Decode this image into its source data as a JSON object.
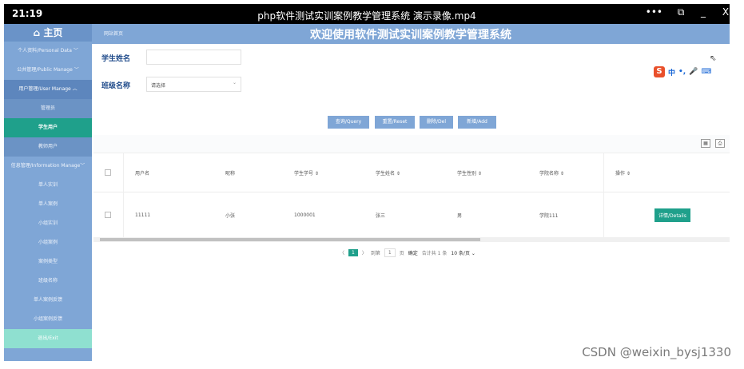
{
  "titlebar": {
    "time": "21:19",
    "title": "php软件测试实训案例教学管理系统 演示录像.mp4",
    "icons": [
      "more-icon",
      "pip-icon",
      "minimize-icon",
      "close-icon"
    ],
    "icon_glyphs": [
      "•••",
      "⧉",
      "_",
      "X"
    ]
  },
  "sidebar": {
    "home": "⌂ 主页",
    "items": [
      {
        "label": "个人资料/Personal Data  ﹀",
        "state": "normal"
      },
      {
        "label": "公共管理/Public Manage  ﹀",
        "state": "normal"
      },
      {
        "label": "用户管理/User Manage  ︿",
        "state": "expanded"
      },
      {
        "label": "管理员",
        "state": "sub"
      },
      {
        "label": "学生用户",
        "state": "active"
      },
      {
        "label": "教师用户",
        "state": "sub"
      },
      {
        "label": "信息管理/Information Manage﹀",
        "state": "normal"
      },
      {
        "label": "单人实训",
        "state": "normal"
      },
      {
        "label": "单人案例",
        "state": "normal"
      },
      {
        "label": "小组实训",
        "state": "normal"
      },
      {
        "label": "小组案例",
        "state": "normal"
      },
      {
        "label": "案例类型",
        "state": "normal"
      },
      {
        "label": "班级名称",
        "state": "normal"
      },
      {
        "label": "单人案例反馈",
        "state": "normal"
      },
      {
        "label": "小组案例反馈",
        "state": "normal"
      },
      {
        "label": "退出/Exit",
        "state": "exit"
      }
    ]
  },
  "topbar": {
    "breadcrumb": "网站首页",
    "title": "欢迎使用软件测试实训案例教学管理系统"
  },
  "search": {
    "student_name_label": "学生姓名",
    "student_name_value": "",
    "class_label": "班级名称",
    "class_value": "请选择"
  },
  "buttons": {
    "query": "查询/Query",
    "reset": "重置/Reset",
    "delete": "删除/Del",
    "add": "新增/Add"
  },
  "ime": {
    "chars": [
      "中",
      "•,",
      "🎤",
      "⌨"
    ]
  },
  "table": {
    "headers": [
      "用户名",
      "昵称",
      "学生学号 ⇕",
      "学生姓名 ⇕",
      "学生性别 ⇕",
      "学院名称 ⇕",
      "操作 ⇕"
    ],
    "rows": [
      {
        "username": "11111",
        "nickname": "小张",
        "student_no": "1000001",
        "name": "张三",
        "gender": "男",
        "college": "学院111",
        "action": "详情/Details"
      }
    ]
  },
  "pager": {
    "prev": "〈",
    "current": "1",
    "next": "〉",
    "goto": "到第",
    "page_input": "1",
    "page_unit": "页",
    "confirm": "确定",
    "total": "合计共 1 条",
    "page_size": "10 条/页 ⌄"
  },
  "watermark": "CSDN @weixin_bysj1330"
}
